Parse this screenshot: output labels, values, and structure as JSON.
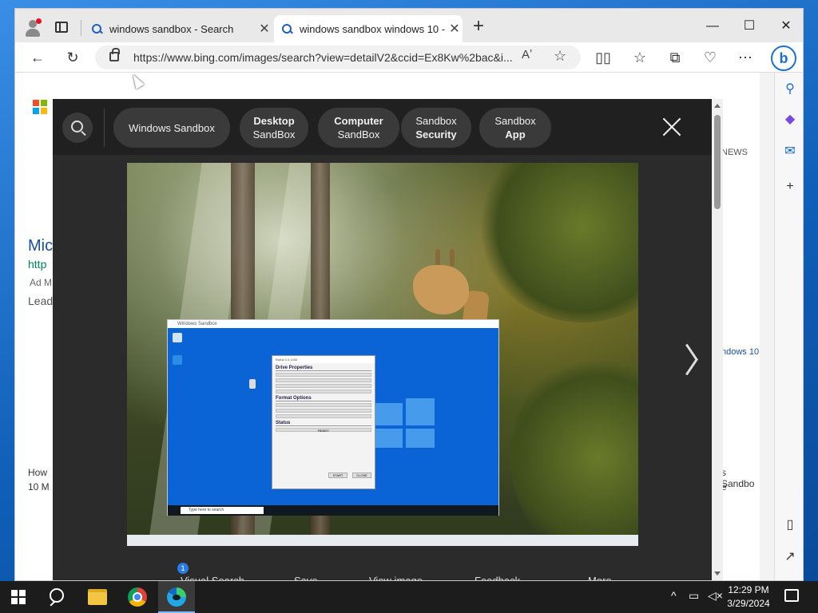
{
  "browser": {
    "tabs": [
      {
        "label": "windows sandbox - Search",
        "active": false
      },
      {
        "label": "windows sandbox windows 10 -",
        "active": true
      }
    ],
    "new_tab_label": "+",
    "window_controls": {
      "minimize": "—",
      "maximize": "☐",
      "close": "✕"
    },
    "url": "https://www.bing.com/images/search?view=detailV2&ccid=Ex8Kw%2bac&i...",
    "read_aloud_label": "Aʼ",
    "bing_logo": "b"
  },
  "page_background": {
    "left_snippets": [
      "Mic",
      "http",
      "Ad M",
      "Lead",
      "How",
      "10 M"
    ],
    "right_snippets": [
      "NEWS",
      "ndows 10",
      "s Sandbo",
      "e"
    ]
  },
  "overlay": {
    "chips": [
      {
        "line1": "Windows Sandbox",
        "line2": "",
        "bold": ""
      },
      {
        "line1": "Desktop",
        "line2": "SandBox",
        "bold": "line1"
      },
      {
        "line1": "Computer",
        "line2": "SandBox",
        "bold": "line1"
      },
      {
        "line1": "Sandbox",
        "line2": "Security",
        "bold": "line2"
      },
      {
        "line1": "Sandbox",
        "line2": "App",
        "bold": "line2"
      }
    ],
    "image": {
      "vm_title": "Windows Sandbox",
      "vm_search_placeholder": "Type here to search",
      "dialog": {
        "title": "Rufus 3.4.1430",
        "sections": [
          "Drive Properties",
          "Format Options",
          "Status"
        ],
        "status_value": "READY",
        "buttons": [
          "START",
          "CLOSE"
        ]
      }
    },
    "actions": [
      {
        "label": "Visual Search",
        "badge": "1"
      },
      {
        "label": "Save"
      },
      {
        "label": "View image"
      },
      {
        "label": "Feedback"
      },
      {
        "label": "More"
      }
    ]
  },
  "taskbar": {
    "clock_time": "12:29 PM",
    "clock_date": "3/29/2024",
    "tray_chevron": "^"
  }
}
